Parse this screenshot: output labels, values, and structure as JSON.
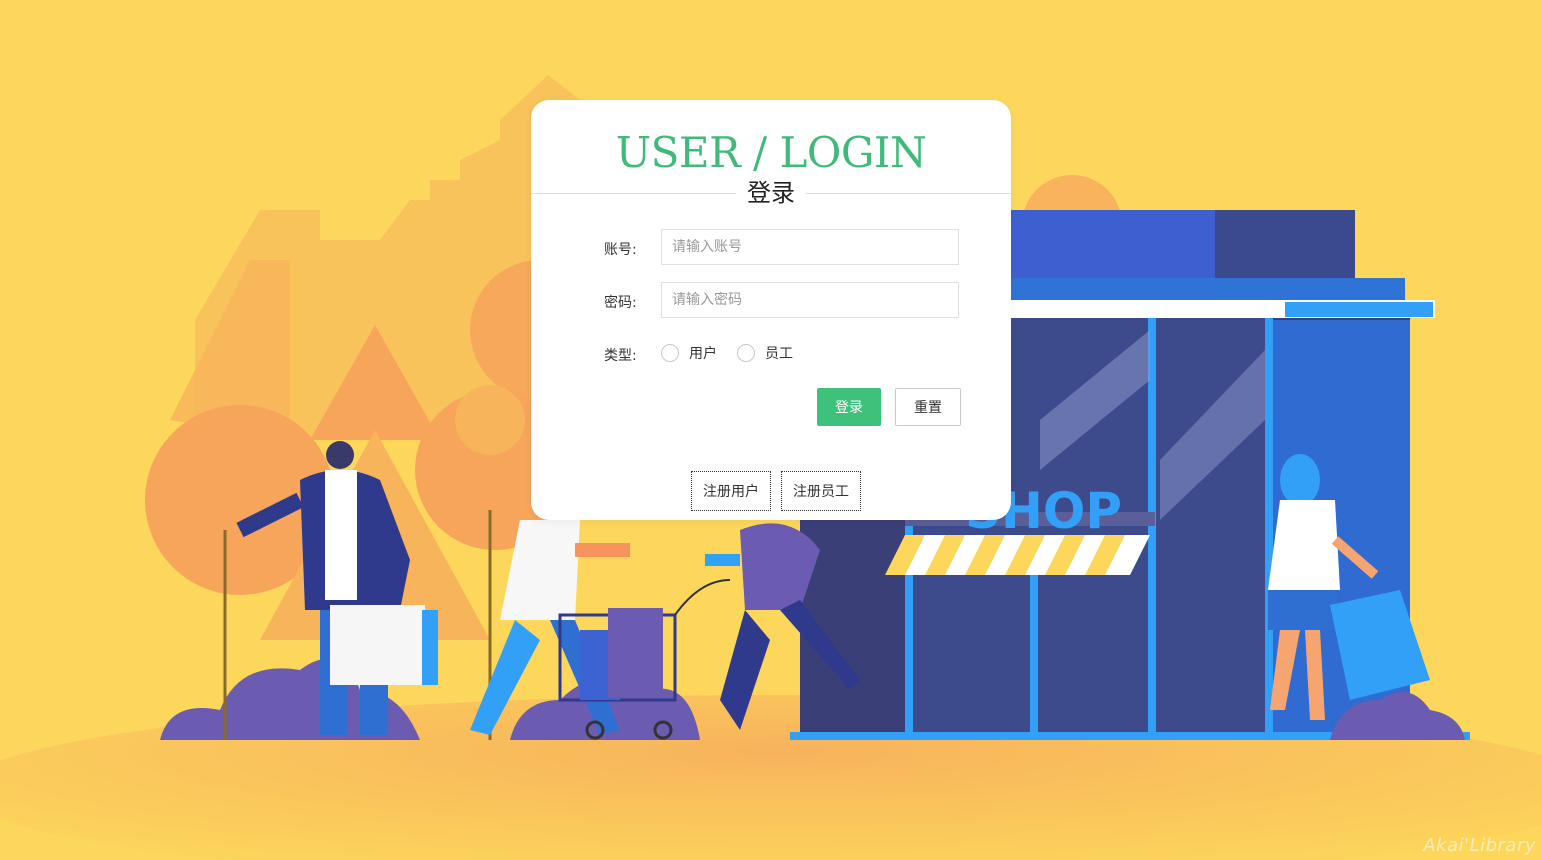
{
  "login": {
    "title": "USER / LOGIN",
    "subtitle": "登录",
    "account_label": "账号:",
    "account_placeholder": "请输入账号",
    "password_label": "密码:",
    "password_placeholder": "请输入密码",
    "type_label": "类型:",
    "type_options": [
      "用户",
      "员工"
    ],
    "login_button": "登录",
    "reset_button": "重置",
    "register_user_button": "注册用户",
    "register_staff_button": "注册员工"
  },
  "background": {
    "shop_sign": "SHOP",
    "watermark": "Akai'Library"
  },
  "colors": {
    "background": "#fcd75b",
    "accent": "#3ec17b",
    "title": "#3fba7a"
  }
}
